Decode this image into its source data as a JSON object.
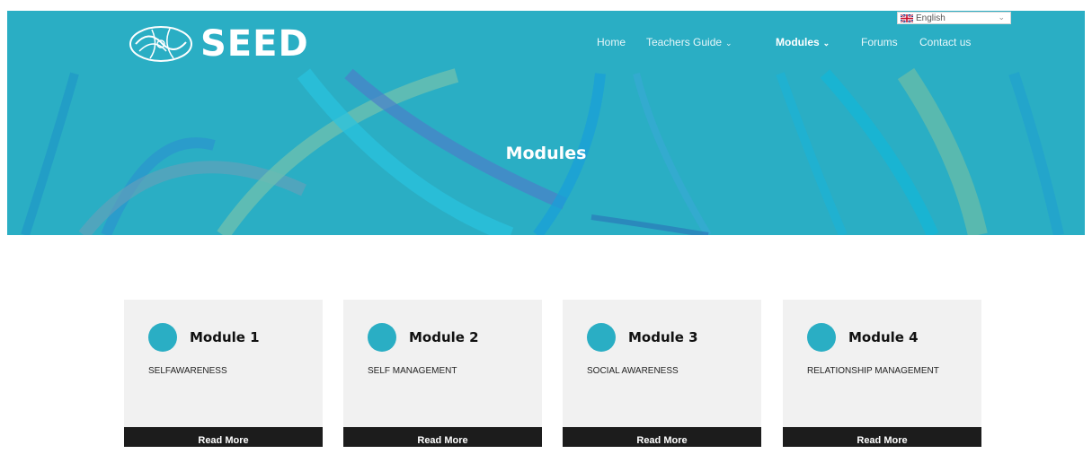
{
  "logo": {
    "text": "SEED",
    "icon": "brain-icon"
  },
  "language": {
    "selected": "English",
    "flag": "uk-flag-icon"
  },
  "nav": {
    "items": [
      {
        "label": "Home",
        "dropdown": false,
        "active": false
      },
      {
        "label": "Teachers Guide",
        "dropdown": true,
        "active": false
      },
      {
        "label": "Modules",
        "dropdown": true,
        "active": true
      },
      {
        "label": "Forums",
        "dropdown": false,
        "active": false
      },
      {
        "label": "Contact us",
        "dropdown": false,
        "active": false
      }
    ]
  },
  "hero": {
    "title": "Modules"
  },
  "modules": [
    {
      "title": "Module 1",
      "description": "SELFAWARENESS",
      "button": "Read More"
    },
    {
      "title": "Module 2",
      "description": "SELF MANAGEMENT",
      "button": "Read More"
    },
    {
      "title": "Module 3",
      "description": "SOCIAL AWARENESS",
      "button": "Read More"
    },
    {
      "title": "Module 4",
      "description": "RELATIONSHIP MANAGEMENT",
      "button": "Read More"
    }
  ],
  "colors": {
    "brand": "#2aaec4",
    "button_bg": "#1c1c1c",
    "card_bg": "#f1f1f1"
  }
}
